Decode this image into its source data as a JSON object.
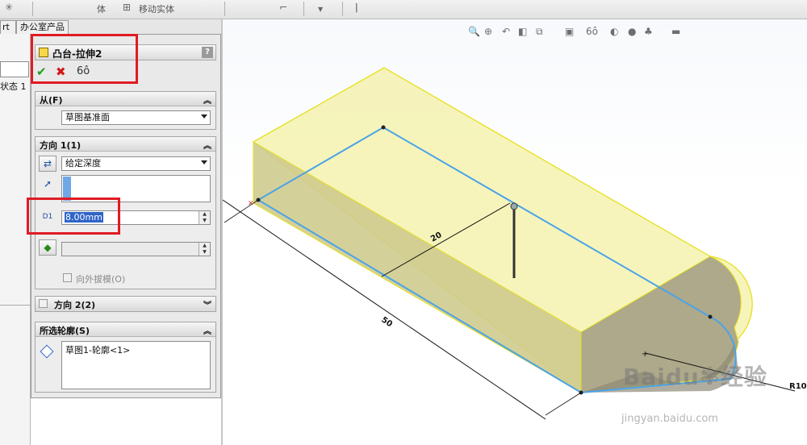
{
  "toolbar": {
    "move_entity_label": "移动实体",
    "partial_label": "体"
  },
  "tabs": {
    "part_tab": "rt",
    "office_tab": "办公室产品"
  },
  "tree": {
    "state_text": "状态 1"
  },
  "feature": {
    "title": "凸台-拉伸2",
    "help": "?",
    "ok_glyph": "✔",
    "cancel_glyph": "✖",
    "preview_glyph": "6ô"
  },
  "from_group": {
    "title": "从(F)",
    "value": "草图基准面"
  },
  "direction1": {
    "title": "方向 1(1)",
    "end_condition": "给定深度",
    "depth_value": "8.00mm",
    "draft_label": "向外拔模(O)"
  },
  "direction2": {
    "title": "方向 2(2)"
  },
  "contours": {
    "title": "所选轮廓(S)",
    "item": "草图1-轮廓<1>"
  },
  "dimensions": {
    "length": "50",
    "width": "20",
    "radius": "R10"
  },
  "watermark": {
    "brand": "Baidu",
    "brand_cn": "经验",
    "url": "jingyan.baidu.com"
  },
  "colors": {
    "highlight_red": "#e01b24",
    "selection_blue": "#2f64c8",
    "preview_yellow": "#f1ee9a",
    "edge_blue": "#4aa3e8"
  }
}
